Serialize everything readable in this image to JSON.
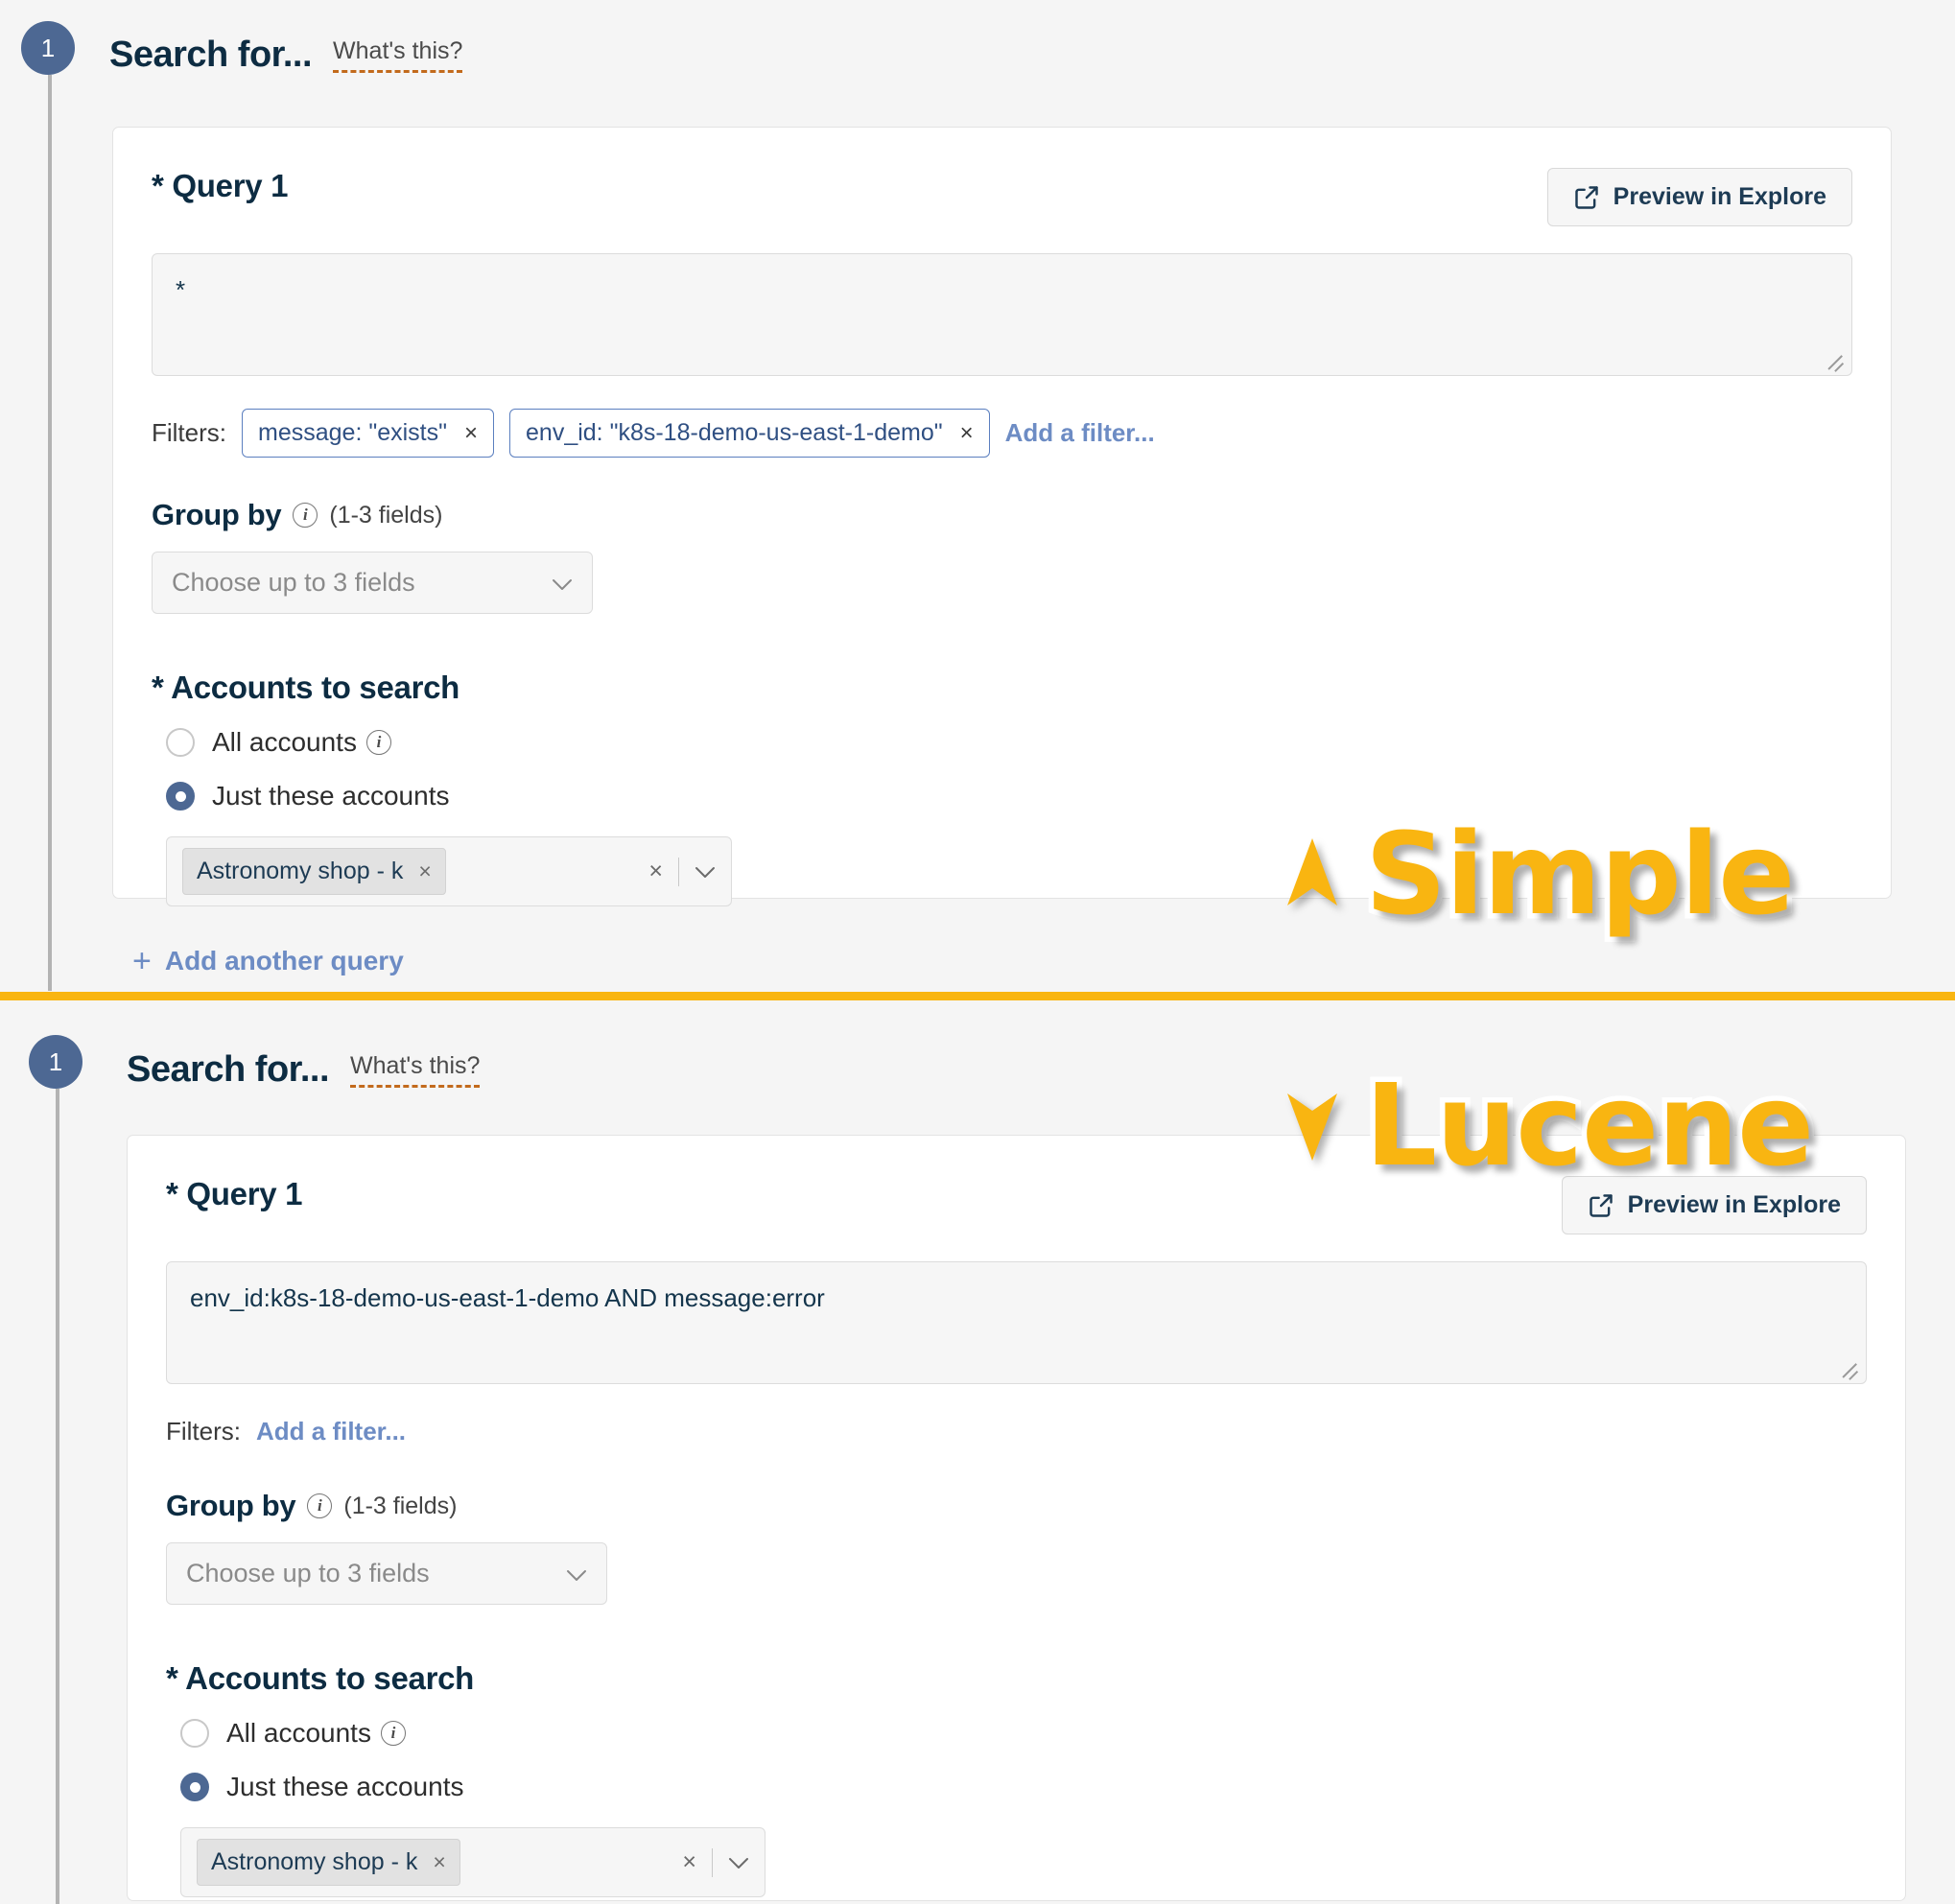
{
  "panels": [
    {
      "step_number": "1",
      "title": "Search for...",
      "whats_this": "What's this?",
      "query_label": "* Query 1",
      "preview_button": "Preview in Explore",
      "preview_icon": "external-link-icon",
      "query_text": "*",
      "filters_label": "Filters:",
      "filters": [
        {
          "text": "message: \"exists\"",
          "remove": "×"
        },
        {
          "text": "env_id: \"k8s-18-demo-us-east-1-demo\"",
          "remove": "×"
        }
      ],
      "add_filter": "Add a filter...",
      "group_by_title": "Group by",
      "group_by_hint": "(1-3 fields)",
      "group_by_placeholder": "Choose up to 3 fields",
      "accounts_title": "* Accounts to search",
      "radio_all": "All accounts",
      "radio_just": "Just these accounts",
      "selected_radio": "just",
      "account_chip": "Astronomy shop - k",
      "account_chip_remove": "×",
      "multiselect_clear": "×",
      "add_another_query": "Add another query"
    },
    {
      "step_number": "1",
      "title": "Search for...",
      "whats_this": "What's this?",
      "query_label": "* Query 1",
      "preview_button": "Preview in Explore",
      "preview_icon": "external-link-icon",
      "query_text": "env_id:k8s-18-demo-us-east-1-demo AND message:error",
      "filters_label": "Filters:",
      "filters": [],
      "add_filter": "Add a filter...",
      "group_by_title": "Group by",
      "group_by_hint": "(1-3 fields)",
      "group_by_placeholder": "Choose up to 3 fields",
      "accounts_title": "* Accounts to search",
      "radio_all": "All accounts",
      "radio_just": "Just these accounts",
      "selected_radio": "just",
      "account_chip": "Astronomy shop - k",
      "account_chip_remove": "×",
      "multiselect_clear": "×"
    }
  ],
  "annotations": {
    "simple": "Simple",
    "lucene": "Lucene"
  },
  "colors": {
    "accent_yellow": "#f9b511",
    "step_blue": "#4d6893",
    "heading_navy": "#0d2c42",
    "link_blue": "#6d8cc4",
    "chip_border_blue": "#5b7fbf"
  }
}
